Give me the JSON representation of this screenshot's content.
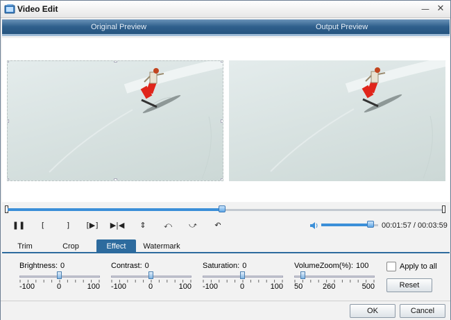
{
  "window": {
    "title": "Video Edit",
    "minimize": "—",
    "close": "✕"
  },
  "preview": {
    "original_label": "Original Preview",
    "output_label": "Output Preview"
  },
  "playback": {
    "time": "00:01:57 / 00:03:59",
    "position": 0.492,
    "volume": 0.86
  },
  "controls": [
    {
      "name": "pause-button",
      "glyph": "❚❚"
    },
    {
      "name": "mark-in-button",
      "glyph": "["
    },
    {
      "name": "mark-out-button",
      "glyph": "]"
    },
    {
      "name": "play-segment-button",
      "glyph": "[▶]"
    },
    {
      "name": "jump-to-button",
      "glyph": "▶|◀"
    },
    {
      "name": "flip-vertical-button",
      "glyph": "⇕"
    },
    {
      "name": "rotate-left-button",
      "glyph": "⤺"
    },
    {
      "name": "rotate-right-button",
      "glyph": "⤻"
    },
    {
      "name": "undo-button",
      "glyph": "↶"
    }
  ],
  "tabs": [
    {
      "label": "Trim",
      "active": false
    },
    {
      "label": "Crop",
      "active": false
    },
    {
      "label": "Effect",
      "active": true
    },
    {
      "label": "Watermark",
      "active": false
    }
  ],
  "effect": {
    "sliders": [
      {
        "label": "Brightness:",
        "value": "0",
        "min": "-100",
        "mid": "0",
        "max": "100",
        "fraction": 0.5
      },
      {
        "label": "Contrast:",
        "value": "0",
        "min": "-100",
        "mid": "0",
        "max": "100",
        "fraction": 0.5
      },
      {
        "label": "Saturation:",
        "value": "0",
        "min": "-100",
        "mid": "0",
        "max": "100",
        "fraction": 0.5
      },
      {
        "label": "VolumeZoom(%):",
        "value": "100",
        "min": "50",
        "mid": "260",
        "max": "500",
        "fraction": 0.11
      }
    ],
    "apply_to_all": "Apply to all",
    "reset": "Reset"
  },
  "footer": {
    "ok": "OK",
    "cancel": "Cancel"
  },
  "colors": {
    "accent": "#2d6b9e",
    "slider_fill": "#3b8fd8",
    "snowboarder_pants": "#e0251b"
  }
}
